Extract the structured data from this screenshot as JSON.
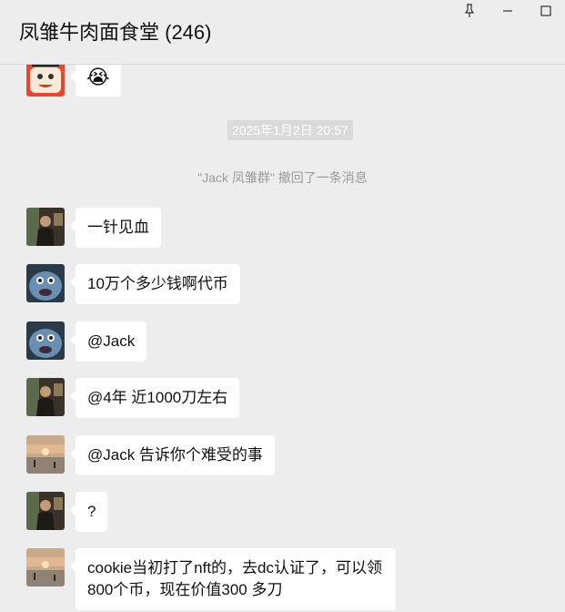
{
  "window": {
    "title": "凤雏牛肉面食堂 (246)"
  },
  "controls": {
    "pin_icon": "pin-icon",
    "minimize_icon": "minimize-icon",
    "maximize_icon": "maximize-icon"
  },
  "chat": {
    "first_emoji": "😭",
    "timestamp": "2025年1月2日 20:57",
    "recall_notice": "\"Jack 凤雏群\" 撤回了一条消息",
    "messages": [
      {
        "text": "一针见血",
        "avatar": "man-dark-photo"
      },
      {
        "text": "10万个多少钱啊代币",
        "avatar": "blue-monster"
      },
      {
        "text": "@Jack",
        "avatar": "blue-monster"
      },
      {
        "text": "@4年 近1000刀左右",
        "avatar": "man-dark-photo"
      },
      {
        "text": "@Jack 告诉你个难受的事",
        "avatar": "sunset-lake"
      },
      {
        "text": "?",
        "avatar": "man-dark-photo"
      },
      {
        "text": "cookie当初打了nft的，去dc认证了，可以领800个币，现在价值300 多刀",
        "avatar": "sunset-lake"
      }
    ]
  },
  "colors": {
    "background": "#ededed",
    "bubble": "#ffffff",
    "timestamp_bg": "#dadada",
    "notice_text": "#9a9a9a"
  }
}
